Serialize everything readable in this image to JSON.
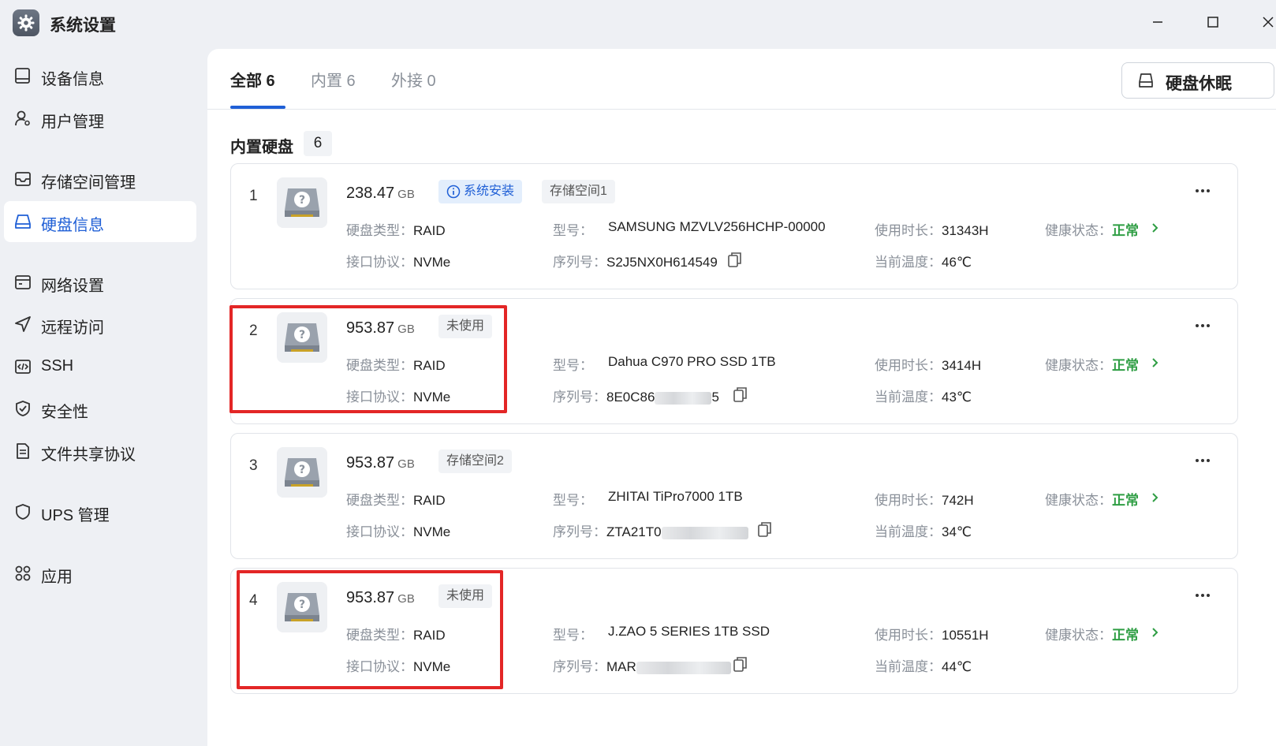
{
  "window": {
    "title": "系统设置"
  },
  "sidebar": {
    "items": [
      {
        "label": "设备信息",
        "icon": "monitor-icon"
      },
      {
        "label": "用户管理",
        "icon": "user-gear-icon"
      },
      {
        "label": "存储空间管理",
        "icon": "storage-icon"
      },
      {
        "label": "硬盘信息",
        "icon": "harddisk-icon",
        "active": true
      },
      {
        "label": "网络设置",
        "icon": "network-icon"
      },
      {
        "label": "远程访问",
        "icon": "send-icon"
      },
      {
        "label": "SSH",
        "icon": "code-icon"
      },
      {
        "label": "安全性",
        "icon": "shield-check-icon"
      },
      {
        "label": "文件共享协议",
        "icon": "document-icon"
      },
      {
        "label": "UPS 管理",
        "icon": "shield-icon"
      },
      {
        "label": "应用",
        "icon": "apps-icon"
      }
    ]
  },
  "tabs": [
    {
      "label": "全部 6",
      "active": true
    },
    {
      "label": "内置 6"
    },
    {
      "label": "外接 0"
    }
  ],
  "sleep_button": {
    "label": "硬盘休眠"
  },
  "section": {
    "title": "内置硬盘",
    "count": "6"
  },
  "labels": {
    "disk_type": "硬盘类型：",
    "interface": "接口协议：",
    "model": "型号：",
    "serial": "序列号：",
    "usage": "使用时长：",
    "temp": "当前温度：",
    "health": "健康状态："
  },
  "disks": [
    {
      "index": "1",
      "capacity": "238.47",
      "unit": "GB",
      "tags": [
        "系统安装",
        "存储空间1"
      ],
      "type": "RAID",
      "interface": "NVMe",
      "model": "SAMSUNG MZVLV256HCHP-00000",
      "serial": "S2J5NX0H614549",
      "usage": "31343H",
      "temp": "46℃",
      "health": "正常"
    },
    {
      "index": "2",
      "capacity": "953.87",
      "unit": "GB",
      "tags": [
        "未使用"
      ],
      "type": "RAID",
      "interface": "NVMe",
      "model": "Dahua C970 PRO SSD 1TB",
      "serial_prefix": "8E0C86",
      "serial_suffix": "5",
      "usage": "3414H",
      "temp": "43℃",
      "health": "正常"
    },
    {
      "index": "3",
      "capacity": "953.87",
      "unit": "GB",
      "tags": [
        "存储空间2"
      ],
      "type": "RAID",
      "interface": "NVMe",
      "model": "ZHITAI TiPro7000 1TB",
      "serial_prefix": "ZTA21T0",
      "usage": "742H",
      "temp": "34℃",
      "health": "正常"
    },
    {
      "index": "4",
      "capacity": "953.87",
      "unit": "GB",
      "tags": [
        "未使用"
      ],
      "type": "RAID",
      "interface": "NVMe",
      "model": "J.ZAO 5 SERIES 1TB SSD",
      "serial_prefix": "MAR",
      "usage": "10551H",
      "temp": "44℃",
      "health": "正常"
    }
  ],
  "colors": {
    "accent": "#1f5fd6",
    "health_ok": "#2f9e44",
    "highlight_box": "#e32626"
  }
}
